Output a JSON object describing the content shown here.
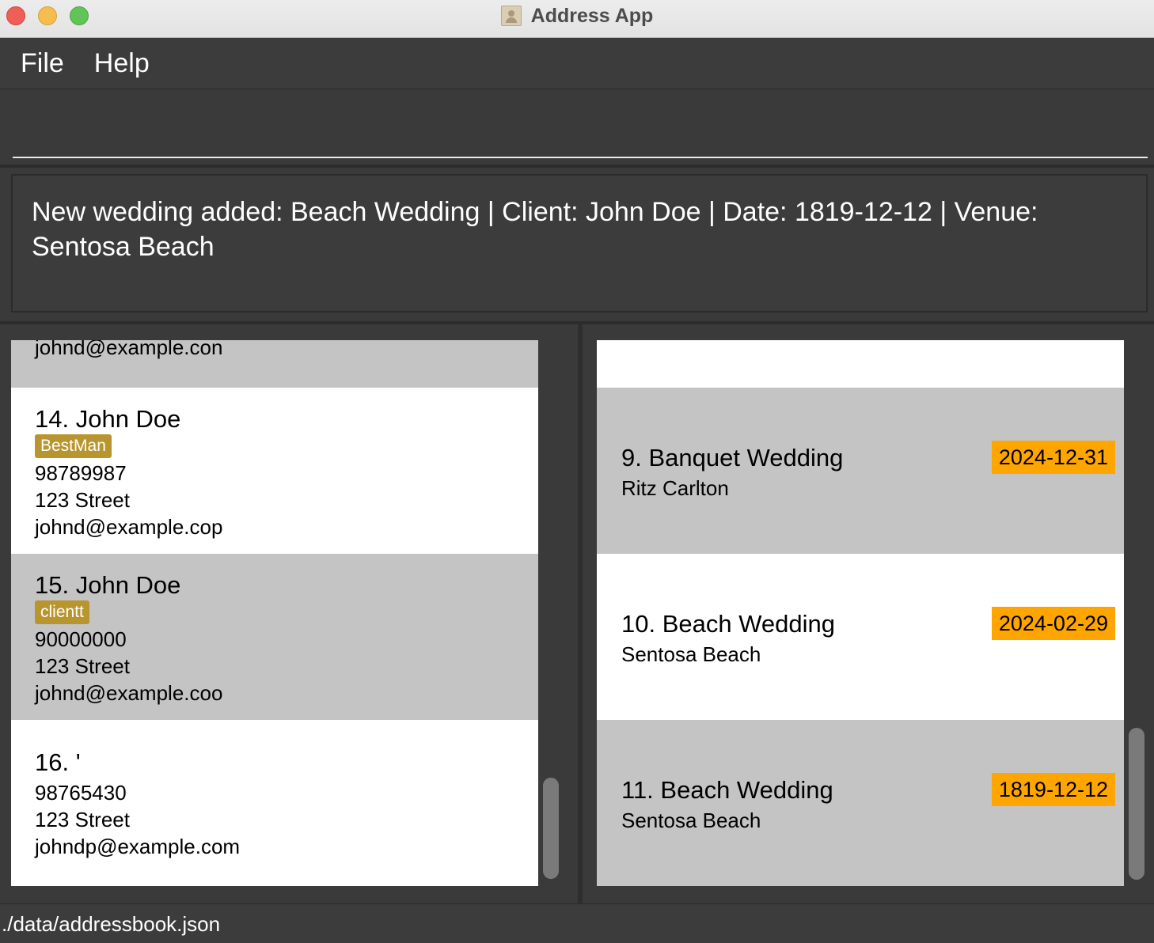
{
  "window": {
    "title": "Address App"
  },
  "menu": {
    "file": "File",
    "help": "Help"
  },
  "command": {
    "value": "",
    "placeholder": ""
  },
  "result": {
    "message": "New wedding added: Beach Wedding | Client: John Doe | Date: 1819-12-12 | Venue: Sentosa Beach"
  },
  "persons": {
    "partial_email": "johnd@example.con",
    "items": [
      {
        "name": "14. John Doe",
        "tag": "BestMan",
        "phone": "98789987",
        "address": "123 Street",
        "email": "johnd@example.cop"
      },
      {
        "name": "15. John Doe",
        "tag": "clientt",
        "phone": "90000000",
        "address": "123 Street",
        "email": "johnd@example.coo"
      },
      {
        "name": "16. '",
        "phone": "98765430",
        "address": "123 Street",
        "email": "johndp@example.com"
      }
    ]
  },
  "weddings": {
    "items": [
      {
        "name": "9. Banquet Wedding",
        "venue": "Ritz Carlton",
        "date": "2024-12-31"
      },
      {
        "name": "10. Beach Wedding",
        "venue": "Sentosa Beach",
        "date": "2024-02-29"
      },
      {
        "name": "11. Beach Wedding",
        "venue": "Sentosa Beach",
        "date": "1819-12-12"
      }
    ]
  },
  "status": {
    "path": "./data/addressbook.json"
  },
  "colors": {
    "tag": "#b8952e",
    "date_badge": "#ffa500",
    "card_alt": "#c4c4c4",
    "background": "#3a3a3a"
  }
}
